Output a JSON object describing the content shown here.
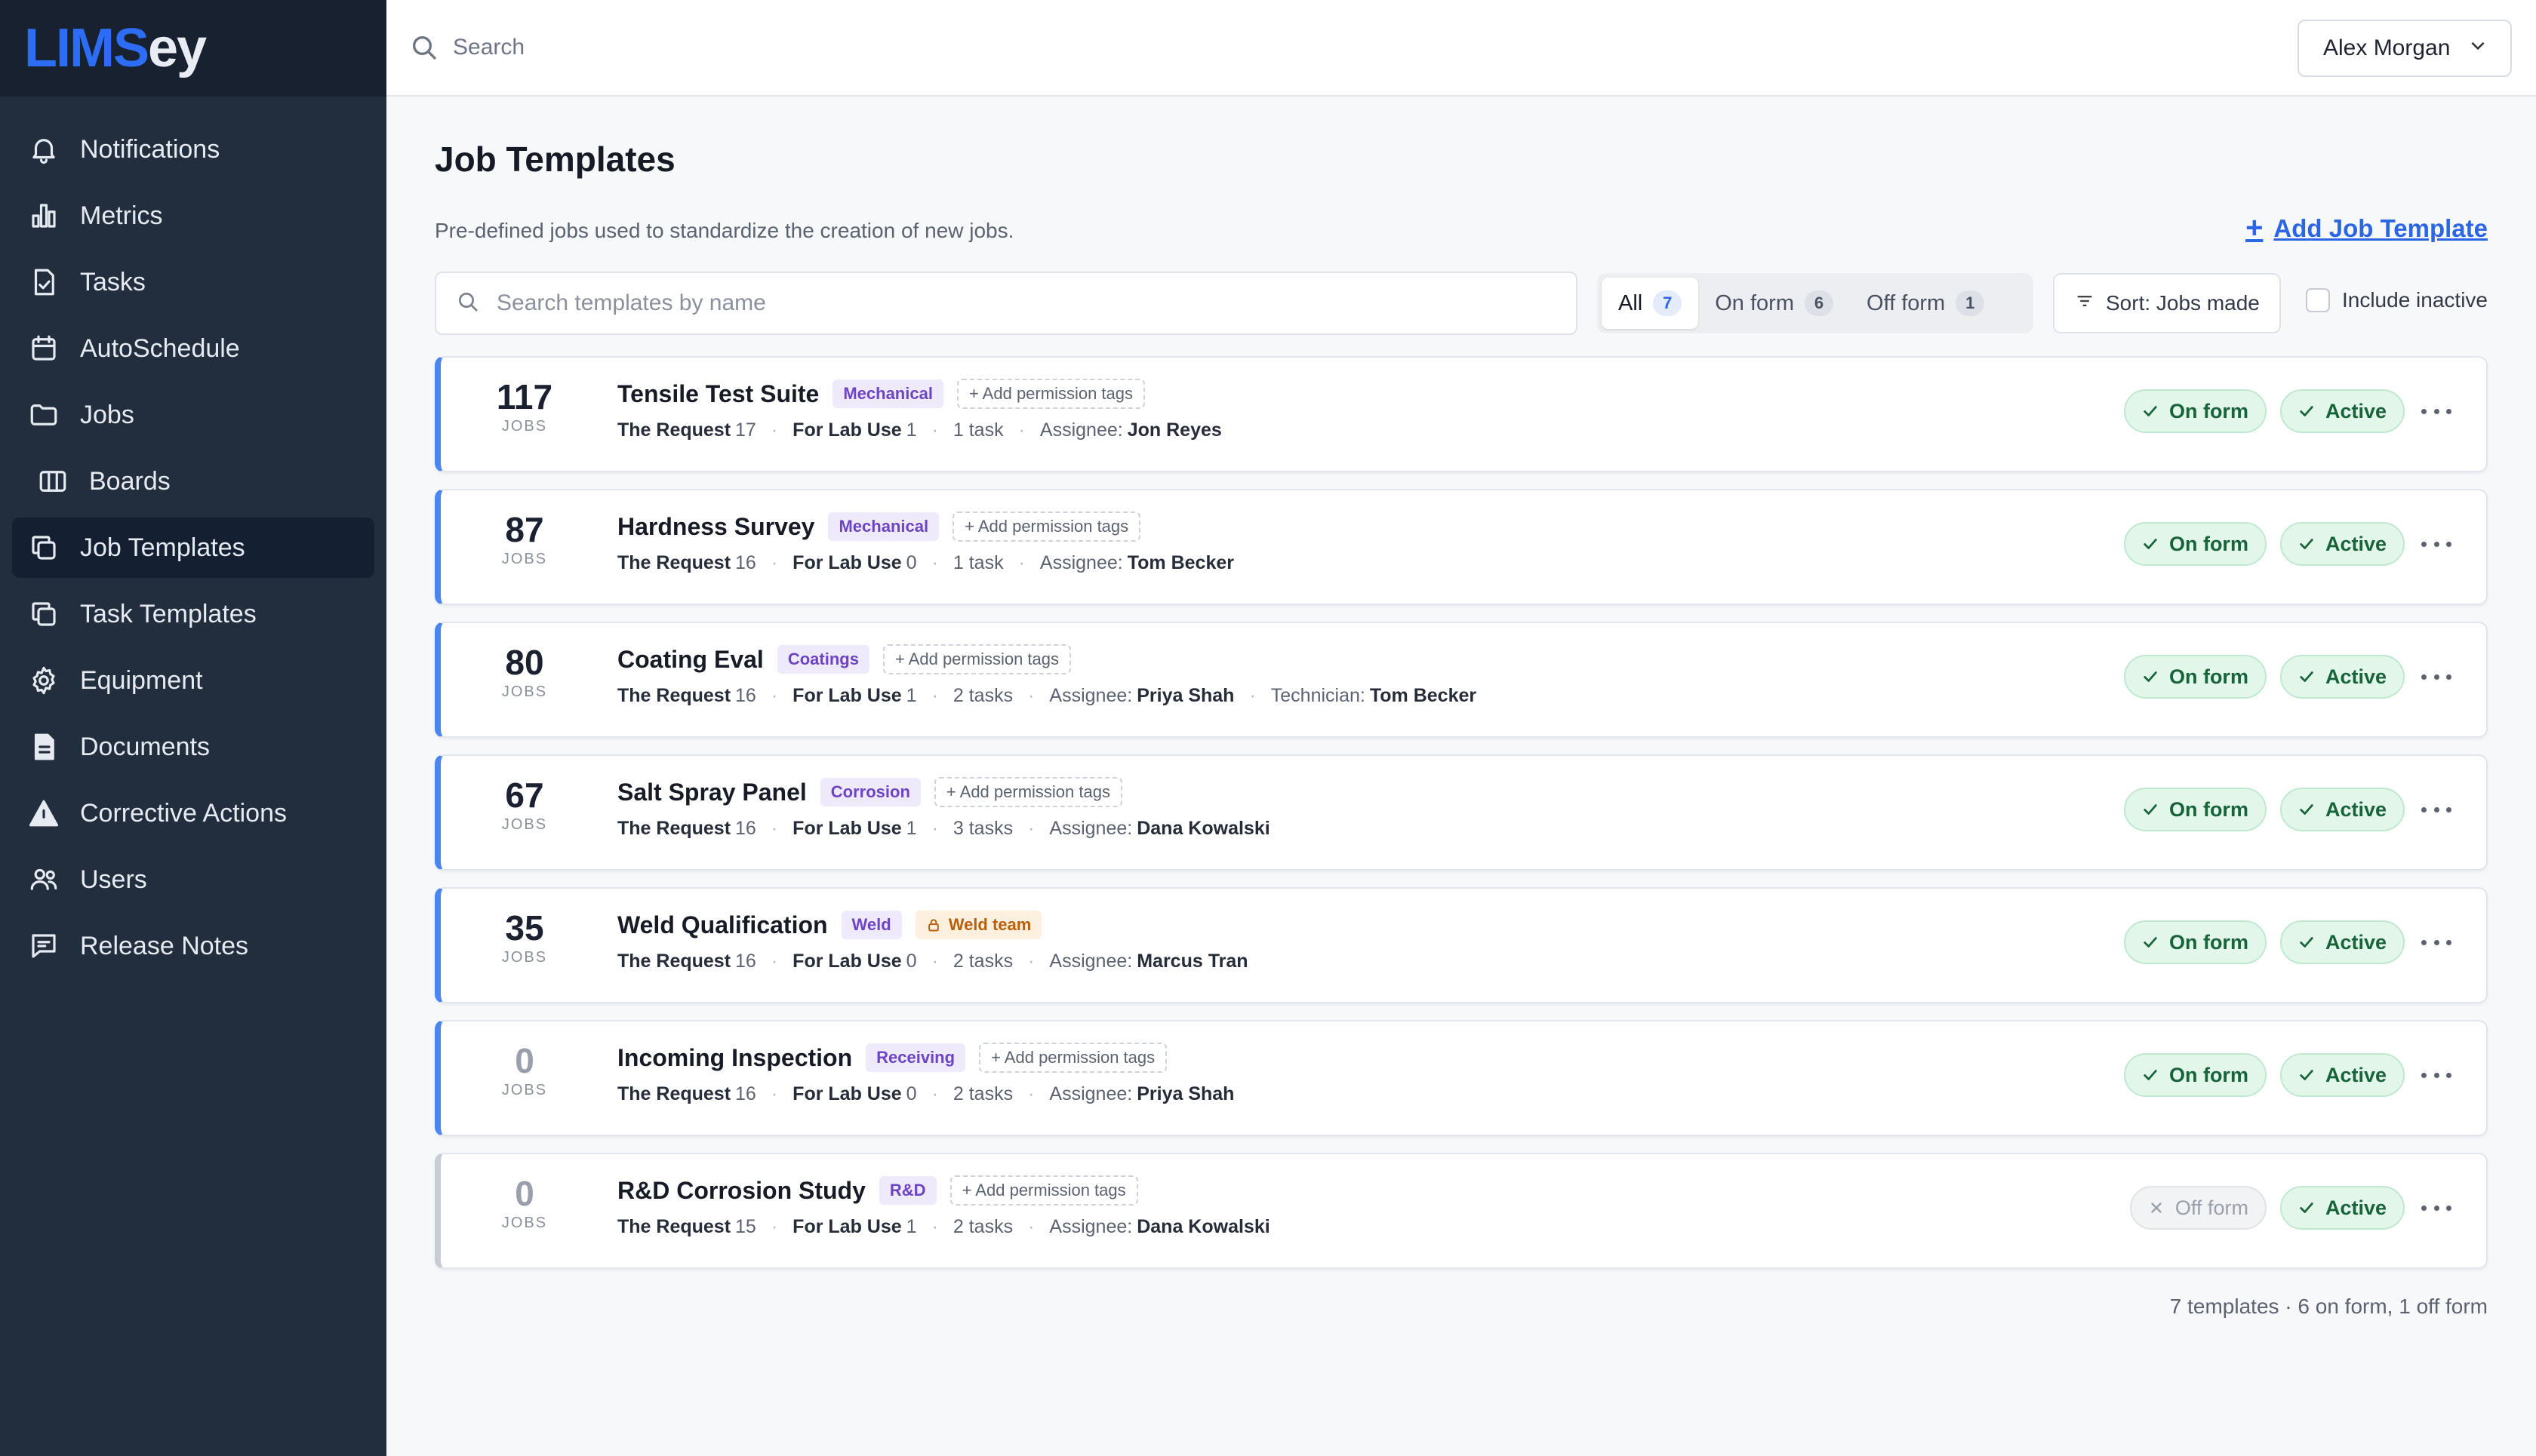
{
  "brand": {
    "logo_a": "LIMS",
    "logo_b": "ey"
  },
  "sidebar": {
    "items": [
      {
        "label": "Notifications",
        "icon": "bell-icon"
      },
      {
        "label": "Metrics",
        "icon": "bar-chart-icon"
      },
      {
        "label": "Tasks",
        "icon": "file-check-icon"
      },
      {
        "label": "AutoSchedule",
        "icon": "calendar-icon"
      },
      {
        "label": "Jobs",
        "icon": "folder-icon"
      },
      {
        "label": "Boards",
        "icon": "columns-icon"
      },
      {
        "label": "Job Templates",
        "icon": "copy-icon",
        "active": true
      },
      {
        "label": "Task Templates",
        "icon": "copy-icon"
      },
      {
        "label": "Equipment",
        "icon": "gear-icon"
      },
      {
        "label": "Documents",
        "icon": "document-icon"
      },
      {
        "label": "Corrective Actions",
        "icon": "warning-icon"
      },
      {
        "label": "Users",
        "icon": "users-icon"
      },
      {
        "label": "Release Notes",
        "icon": "message-icon"
      }
    ]
  },
  "topbar": {
    "search_placeholder": "Search",
    "user_name": "Alex Morgan"
  },
  "page": {
    "title": "Job Templates",
    "subtitle": "Pre-defined jobs used to standardize the creation of new jobs.",
    "add_label": "Add Job Template",
    "add_symbol": "+"
  },
  "filters": {
    "search_placeholder": "Search templates by name",
    "tabs": [
      {
        "label": "All",
        "count": "7",
        "selected": true
      },
      {
        "label": "On form",
        "count": "6"
      },
      {
        "label": "Off form",
        "count": "1"
      }
    ],
    "sort_label": "Sort: Jobs made",
    "include_inactive_label": "Include inactive"
  },
  "labels": {
    "jobs_unit": "JOBS",
    "request": "The Request",
    "lab_use": "For Lab Use",
    "assignee": "Assignee:",
    "technician": "Technician:",
    "add_perm": "+ Add permission tags"
  },
  "templates": [
    {
      "jobs": "117",
      "name": "Tensile Test Suite",
      "tag": "Mechanical",
      "request": "17",
      "lab": "1",
      "tasks": "1 task",
      "assignee": "Jon Reyes",
      "form": "On form",
      "status": "Active"
    },
    {
      "jobs": "87",
      "name": "Hardness Survey",
      "tag": "Mechanical",
      "request": "16",
      "lab": "0",
      "tasks": "1 task",
      "assignee": "Tom Becker",
      "form": "On form",
      "status": "Active"
    },
    {
      "jobs": "80",
      "name": "Coating Eval",
      "tag": "Coatings",
      "request": "16",
      "lab": "1",
      "tasks": "2 tasks",
      "assignee": "Priya Shah",
      "technician": "Tom Becker",
      "form": "On form",
      "status": "Active"
    },
    {
      "jobs": "67",
      "name": "Salt Spray Panel",
      "tag": "Corrosion",
      "request": "16",
      "lab": "1",
      "tasks": "3 tasks",
      "assignee": "Dana Kowalski",
      "form": "On form",
      "status": "Active"
    },
    {
      "jobs": "35",
      "name": "Weld Qualification",
      "tag": "Weld",
      "team_tag": "Weld team",
      "request": "16",
      "lab": "0",
      "tasks": "2 tasks",
      "assignee": "Marcus Tran",
      "form": "On form",
      "status": "Active"
    },
    {
      "jobs": "0",
      "name": "Incoming Inspection",
      "tag": "Receiving",
      "request": "16",
      "lab": "0",
      "tasks": "2 tasks",
      "assignee": "Priya Shah",
      "form": "On form",
      "status": "Active"
    },
    {
      "jobs": "0",
      "name": "R&D Corrosion Study",
      "tag": "R&D",
      "request": "15",
      "lab": "1",
      "tasks": "2 tasks",
      "assignee": "Dana Kowalski",
      "form": "Off form",
      "status": "Active"
    }
  ],
  "summary": "7 templates · 6 on form, 1 off form",
  "colors": {
    "accent": "#2b66e6",
    "sidebar": "#222d3e",
    "active_green": "#17633a"
  }
}
